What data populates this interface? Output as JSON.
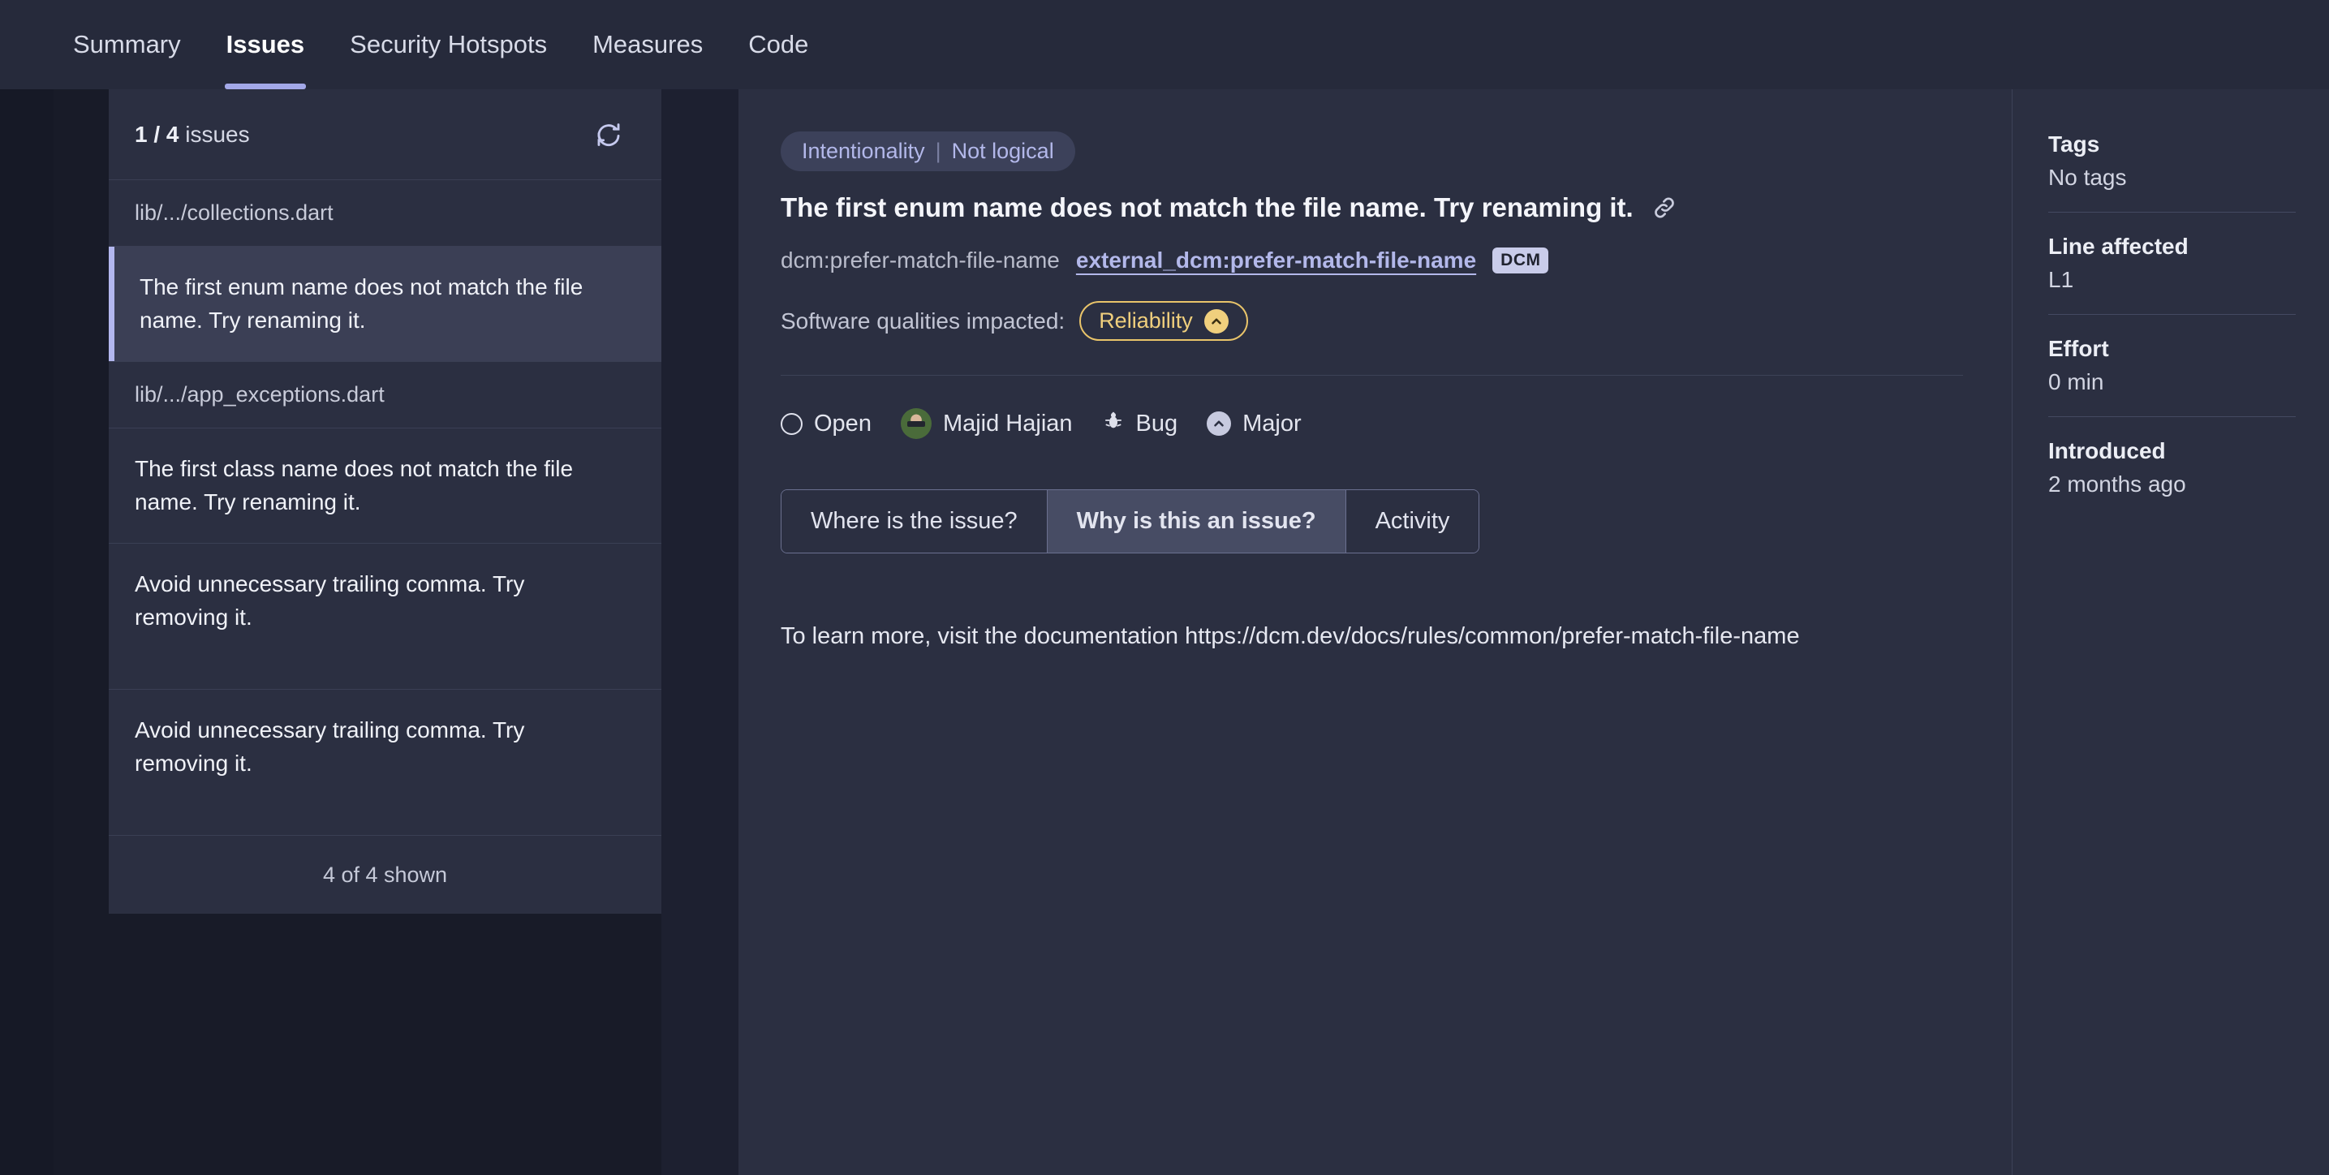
{
  "topnav": {
    "items": [
      {
        "label": "Summary",
        "active": false
      },
      {
        "label": "Issues",
        "active": true
      },
      {
        "label": "Security Hotspots",
        "active": false
      },
      {
        "label": "Measures",
        "active": false
      },
      {
        "label": "Code",
        "active": false
      }
    ]
  },
  "issue_list": {
    "count_current": "1 / 4",
    "count_suffix": "issues",
    "refresh_icon": "refresh-icon",
    "groups": [
      {
        "file": "lib/.../collections.dart",
        "issues": [
          {
            "message": "The first enum name does not match the file name. Try renaming it.",
            "selected": true
          }
        ]
      },
      {
        "file": "lib/.../app_exceptions.dart",
        "issues": [
          {
            "message": "The first class name does not match the file name. Try renaming it.",
            "selected": false
          },
          {
            "message": "Avoid unnecessary trailing comma. Try removing it.",
            "selected": false
          },
          {
            "message": "Avoid unnecessary trailing comma. Try removing it.",
            "selected": false
          }
        ]
      }
    ],
    "footer": "4 of 4 shown"
  },
  "issue_detail": {
    "clean_code_attribute": "Intentionality",
    "clean_code_separator": "|",
    "clean_code_sub_attribute": "Not logical",
    "title": "The first enum name does not match the file name. Try renaming it.",
    "permalink_icon": "link-icon",
    "rule_key": "dcm:prefer-match-file-name",
    "rule_link": "external_dcm:prefer-match-file-name",
    "rule_badge": "DCM",
    "qualities_label": "Software qualities impacted:",
    "quality_badge": "Reliability",
    "quality_severity_icon": "chevron-up-icon",
    "status": "Open",
    "status_icon": "open-circle-icon",
    "assignee": "Majid Hajian",
    "assignee_avatar": "avatar",
    "type": "Bug",
    "type_icon": "bug-icon",
    "severity": "Major",
    "severity_icon": "chevron-up-circle-icon",
    "tabs": [
      {
        "label": "Where is the issue?",
        "active": false
      },
      {
        "label": "Why is this an issue?",
        "active": true
      },
      {
        "label": "Activity",
        "active": false
      }
    ],
    "documentation": "To learn more, visit the documentation https://dcm.dev/docs/rules/common/prefer-match-file-name"
  },
  "meta_sidebar": {
    "blocks": [
      {
        "label": "Tags",
        "value": "No tags"
      },
      {
        "label": "Line affected",
        "value": "L1"
      },
      {
        "label": "Effort",
        "value": "0 min"
      },
      {
        "label": "Introduced",
        "value": "2 months ago"
      }
    ]
  },
  "colors": {
    "accent": "#b3b7ef",
    "panel": "#2b2f41",
    "page_bg": "#1d2030",
    "warning": "#e9c46a"
  }
}
